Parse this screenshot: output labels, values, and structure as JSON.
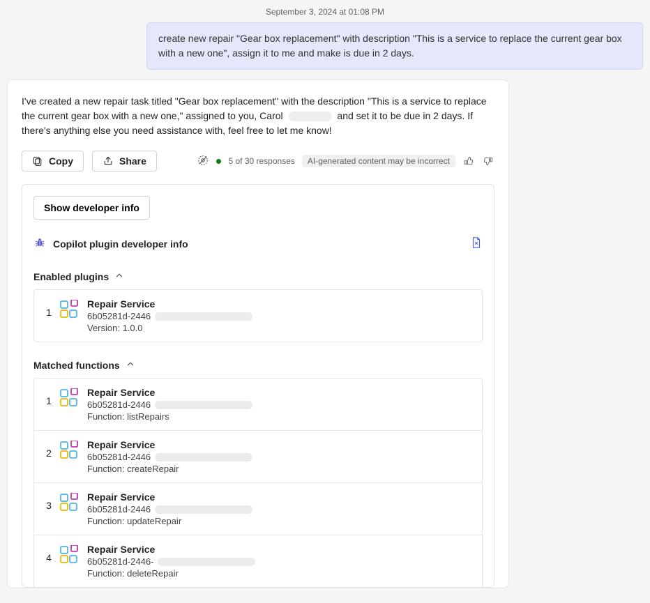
{
  "timestamp": "September 3, 2024 at 01:08 PM",
  "user_message": "create new repair \"Gear box replacement\" with description \"This is a service to replace the current gear box with a new one\", assign it to me and make is due in 2 days.",
  "response": {
    "part1": "I've created a new repair task titled \"Gear box replacement\" with the description \"This is a service to replace the current gear box with a new one,\" assigned to you, Carol",
    "part2": "and set it to be due in 2 days. If there's anything else you need assistance with, feel free to let me know!"
  },
  "toolbar": {
    "copy": "Copy",
    "share": "Share",
    "responses": "5 of 30 responses",
    "ai_label": "AI-generated content may be incorrect"
  },
  "dev": {
    "show_info_btn": "Show developer info",
    "header": "Copilot plugin developer info",
    "enabled_plugins_label": "Enabled plugins",
    "matched_functions_label": "Matched functions",
    "enabled_plugins": [
      {
        "num": "1",
        "name": "Repair Service",
        "id": "6b05281d-2446",
        "meta": "Version: 1.0.0"
      }
    ],
    "matched_functions": [
      {
        "num": "1",
        "name": "Repair Service",
        "id": "6b05281d-2446",
        "meta": "Function: listRepairs"
      },
      {
        "num": "2",
        "name": "Repair Service",
        "id": "6b05281d-2446",
        "meta": "Function: createRepair"
      },
      {
        "num": "3",
        "name": "Repair Service",
        "id": "6b05281d-2446",
        "meta": "Function: updateRepair"
      },
      {
        "num": "4",
        "name": "Repair Service",
        "id": "6b05281d-2446-",
        "meta": "Function: deleteRepair"
      }
    ]
  }
}
